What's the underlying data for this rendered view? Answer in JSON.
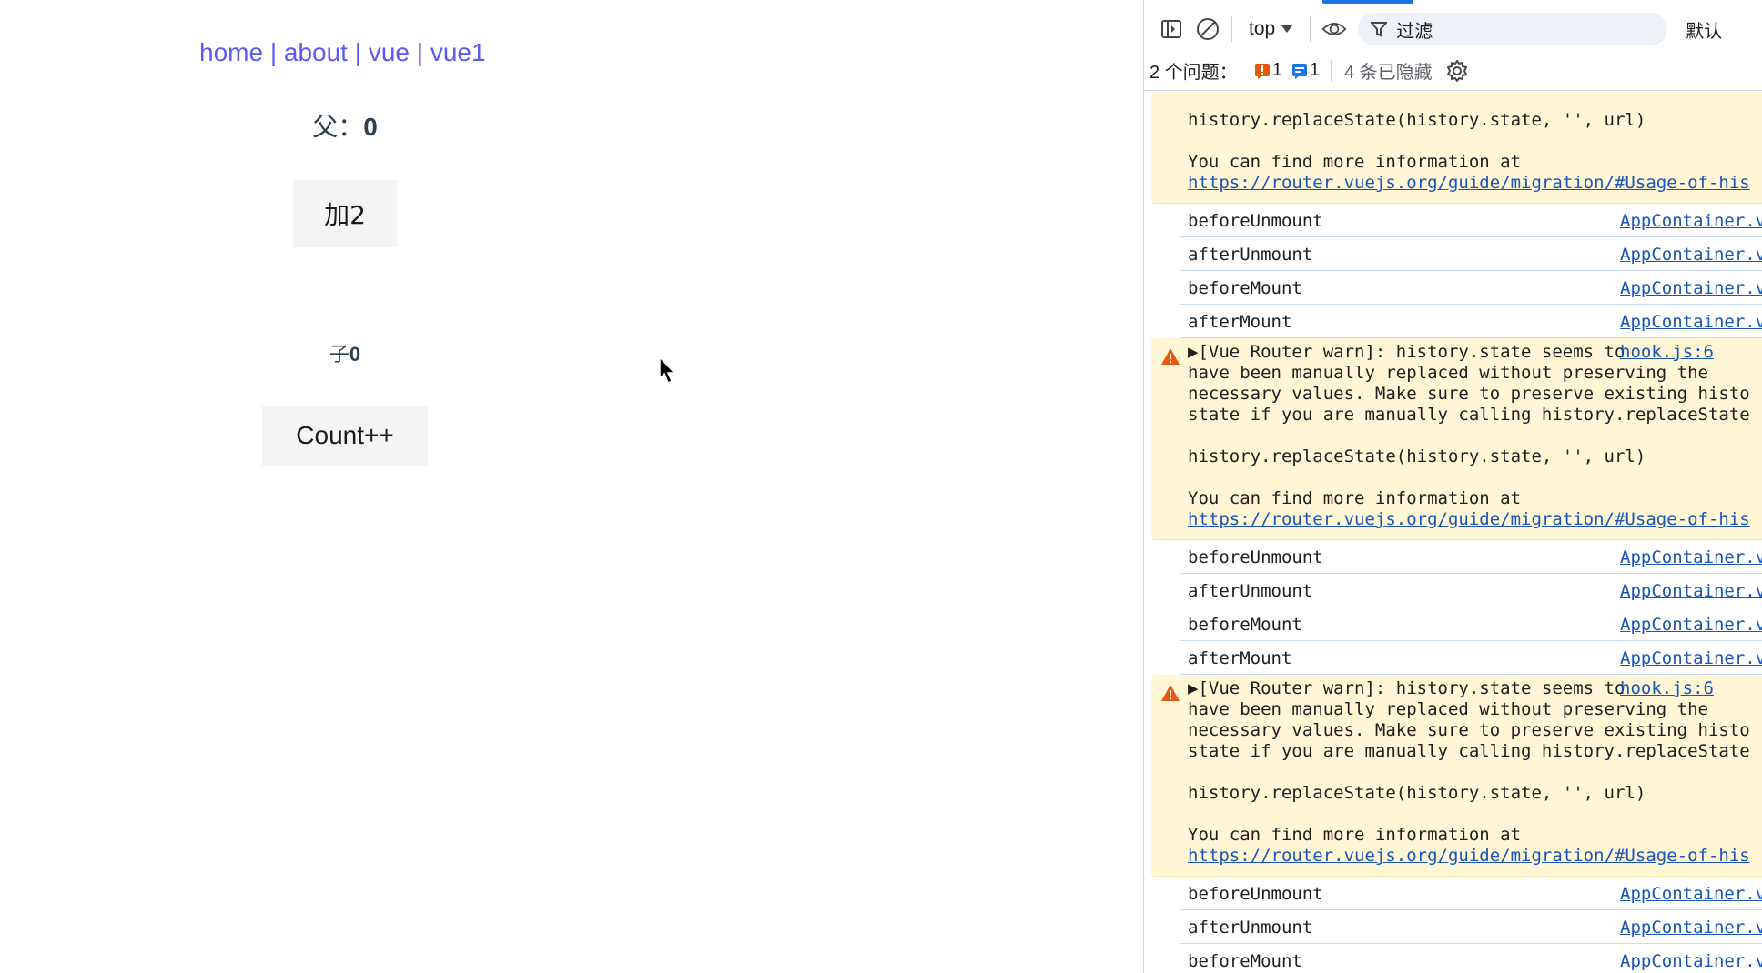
{
  "app": {
    "nav": [
      {
        "label": "home"
      },
      {
        "label": "about"
      },
      {
        "label": "vue"
      },
      {
        "label": "vue1"
      }
    ],
    "nav_separator": "|",
    "parent_label": "父：",
    "parent_value": "0",
    "add_button": "加2",
    "child_label": "子",
    "child_value": "0",
    "count_button": "Count++"
  },
  "devtools": {
    "context": "top",
    "filter_placeholder": "过滤",
    "default_levels": "默认",
    "issues_label": "2 个问题：",
    "issue_error_count": "1",
    "issue_info_count": "1",
    "hidden_label": "4 条已隐藏",
    "colors": {
      "accent": "#1a73e8",
      "warn_bg": "#fef6d5",
      "link": "#1a55b8",
      "error": "#e8590c"
    },
    "top_fragment": {
      "code": "history.replaceState(history.state, '', url)",
      "more_info": "You can find more information at",
      "link": "https://router.vuejs.org/guide/migration/#Usage-of-his"
    },
    "log_groups": [
      [
        {
          "msg": "beforeUnmount",
          "src": "AppContainer.vue:"
        },
        {
          "msg": "afterUnmount",
          "src": "AppContainer.vue:"
        },
        {
          "msg": "beforeMount",
          "src": "AppContainer.vue:"
        },
        {
          "msg": "afterMount",
          "src": "AppContainer.vue:"
        }
      ],
      [
        {
          "msg": "beforeUnmount",
          "src": "AppContainer.vue:"
        },
        {
          "msg": "afterUnmount",
          "src": "AppContainer.vue:"
        },
        {
          "msg": "beforeMount",
          "src": "AppContainer.vue:"
        },
        {
          "msg": "afterMount",
          "src": "AppContainer.vue:"
        }
      ],
      [
        {
          "msg": "beforeUnmount",
          "src": "AppContainer.vue:"
        },
        {
          "msg": "afterUnmount",
          "src": "AppContainer.vue:"
        },
        {
          "msg": "beforeMount",
          "src": "AppContainer.vue:"
        }
      ]
    ],
    "warning": {
      "lines": [
        "▶[Vue Router warn]: history.state seems to",
        "have been manually replaced without preserving the",
        "necessary values. Make sure to preserve existing histo",
        "state if you are manually calling history.replaceState"
      ],
      "source": "hook.js:6",
      "code": "history.replaceState(history.state, '', url)",
      "more_info": "You can find more information at",
      "link": "https://router.vuejs.org/guide/migration/#Usage-of-his"
    }
  }
}
